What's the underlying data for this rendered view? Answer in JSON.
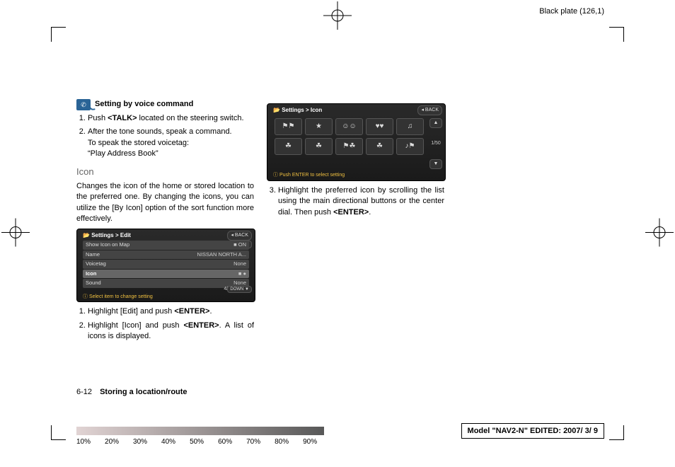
{
  "header": {
    "plate": "Black plate (126,1)"
  },
  "voice": {
    "title": "Setting by voice command",
    "steps": [
      "Push <TALK> located on the steering switch.",
      "After the tone sounds, speak a command."
    ],
    "sub1": "To speak the stored voicetag:",
    "sub2": "“Play Address Book”"
  },
  "icon": {
    "heading": "Icon",
    "desc": "Changes the icon of the home or stored location to the preferred one. By changing the icons, you can utilize the [By Icon] option of the sort function more effectively."
  },
  "screenshot1": {
    "title": "Settings > Edit",
    "back": "◂ BACK",
    "up": "UP ▲",
    "down": "DOWN ▼",
    "counter": "4/10",
    "footer": "ⓘ Select item to change setting",
    "rows": [
      {
        "label": "Show Icon on Map",
        "value": "■ ON"
      },
      {
        "label": "Name",
        "value": "NISSAN NORTH A..."
      },
      {
        "label": "Voicetag",
        "value": "None"
      },
      {
        "label": "Icon",
        "value": "■   ●"
      },
      {
        "label": "Sound",
        "value": "None"
      }
    ]
  },
  "steps_under_ss1": [
    "Highlight [Edit] and push <ENTER>.",
    "Highlight [Icon] and push <ENTER>. A list of icons is displayed."
  ],
  "screenshot2": {
    "title": "Settings > Icon",
    "back": "◂ BACK",
    "up": "▲",
    "down": "▼",
    "counter": "1/50",
    "footer": "ⓘ Push ENTER to select setting",
    "icons": [
      "⚑⚑",
      "★",
      "☺☺",
      "♥♥",
      "♫",
      "☘",
      "☘",
      "⚑☘",
      "☘",
      "♪⚑"
    ]
  },
  "step3": "Highlight the preferred icon by scrolling the list using the main directional buttons or the center dial. Then push <ENTER>.",
  "footer": {
    "page": "6-12",
    "section": "Storing a location/route"
  },
  "percents": [
    "10%",
    "20%",
    "30%",
    "40%",
    "50%",
    "60%",
    "70%",
    "80%",
    "90%"
  ],
  "model": {
    "prefix": "Model ",
    "name": "\"NAV2-N\"",
    "edited": " EDITED: 2007/ 3/ 9"
  }
}
